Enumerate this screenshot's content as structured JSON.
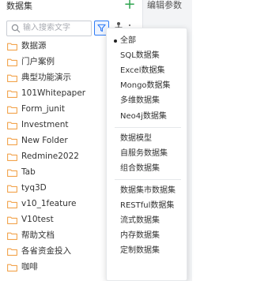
{
  "panel": {
    "title": "数据集",
    "add_label": "+",
    "right_title": "编辑参数"
  },
  "search": {
    "placeholder": "输入搜索文字",
    "value": ""
  },
  "colors": {
    "accent": "#2f7cf6",
    "add_green": "#2ea44f",
    "folder": "#f2a34c"
  },
  "list": {
    "items": [
      {
        "label": "数据源",
        "icon": "folder-icon"
      },
      {
        "label": "门户案例",
        "icon": "folder-icon"
      },
      {
        "label": "典型功能演示",
        "icon": "folder-icon"
      },
      {
        "label": "101Whitepaper",
        "icon": "folder-icon"
      },
      {
        "label": "Form_junit",
        "icon": "folder-icon"
      },
      {
        "label": "Investment",
        "icon": "folder-icon"
      },
      {
        "label": "New Folder",
        "icon": "folder-icon"
      },
      {
        "label": "Redmine2022",
        "icon": "folder-icon"
      },
      {
        "label": "Tab",
        "icon": "folder-icon"
      },
      {
        "label": "tyq3D",
        "icon": "folder-icon"
      },
      {
        "label": "v10_1feature",
        "icon": "folder-icon"
      },
      {
        "label": "V10test",
        "icon": "folder-icon"
      },
      {
        "label": "帮助文档",
        "icon": "folder-icon"
      },
      {
        "label": "各省资金投入",
        "icon": "folder-icon"
      },
      {
        "label": "咖啡",
        "icon": "folder-icon"
      }
    ]
  },
  "filter_menu": {
    "selected": "全部",
    "groups": [
      [
        "全部",
        "SQL数据集",
        "Excel数据集",
        "Mongo数据集",
        "多维数据集",
        "Neo4j数据集"
      ],
      [
        "数据模型",
        "自服务数据集",
        "组合数据集"
      ],
      [
        "数据集市数据集",
        "RESTful数据集",
        "流式数据集",
        "内存数据集",
        "定制数据集"
      ]
    ]
  }
}
